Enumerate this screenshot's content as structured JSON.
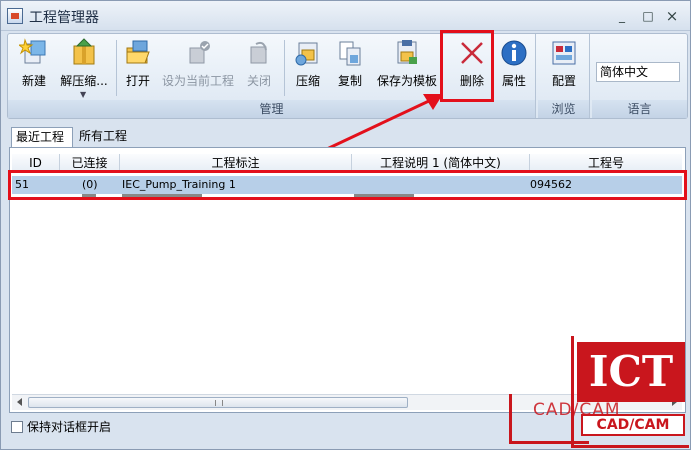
{
  "window": {
    "title": "工程管理器",
    "min_label": "_",
    "max_label": "□",
    "close_label": "×"
  },
  "ribbon": {
    "groups": {
      "manage": "管理",
      "browse": "浏览",
      "language": "语言"
    },
    "buttons": {
      "new": "新建",
      "unzip": "解压缩...",
      "open": "打开",
      "set_current": "设为当前工程",
      "close": "关闭",
      "compress": "压缩",
      "copy": "复制",
      "save_template": "保存为模板",
      "delete": "删除",
      "properties": "属性",
      "configure": "配置"
    },
    "language_value": "简体中文"
  },
  "tabs": {
    "recent": "最近工程",
    "all": "所有工程"
  },
  "table": {
    "headers": [
      "ID",
      "已连接",
      "工程标注",
      "工程说明 1 (简体中文)",
      "工程号"
    ],
    "rows": [
      {
        "id": "51",
        "connected": "(0)",
        "label": "IEC_Pump_Training 1",
        "desc": "",
        "number": "094562"
      }
    ]
  },
  "footer": {
    "keep_open": "保持对话框开启"
  },
  "logo": {
    "ict": "ICT",
    "cadcam_ghost": "CAD/CAM",
    "cadcam": "CAD/CAM"
  },
  "colors": {
    "highlight": "#e3101b",
    "selection": "#b7cfe8",
    "brand": "#c9161d"
  },
  "icons": {
    "new": "new-project-icon",
    "unzip": "unzip-icon",
    "open": "open-folder-icon",
    "delete": "delete-x-icon",
    "properties": "info-icon",
    "configure": "configure-icon"
  }
}
